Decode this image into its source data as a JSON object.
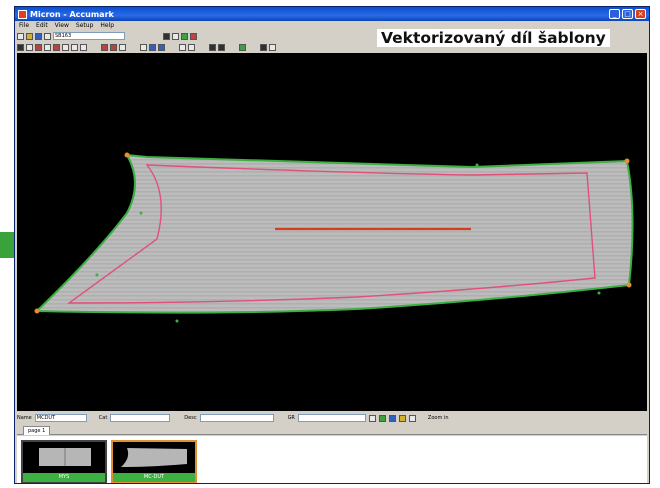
{
  "window": {
    "title": "Micron - Accumark",
    "caption": "Vektorizovaný díl šablony"
  },
  "menu": [
    "File",
    "Edit",
    "View",
    "Setup",
    "Help"
  ],
  "toolbar": {
    "field_value": "SB163"
  },
  "status": {
    "name_label": "Name",
    "name_value": "MCDUT",
    "cat_label": "Cat",
    "desc_label": "Desc",
    "gr_label": "GR",
    "zoom_label": "Zoom in"
  },
  "tabs": {
    "page": "page 1"
  },
  "thumbnails": [
    {
      "label": "MYS"
    },
    {
      "label": "MC-DUT"
    }
  ],
  "colors": {
    "piece_outline": "#3cb043",
    "seam_line": "#e0507a",
    "grainline": "#d04020"
  }
}
